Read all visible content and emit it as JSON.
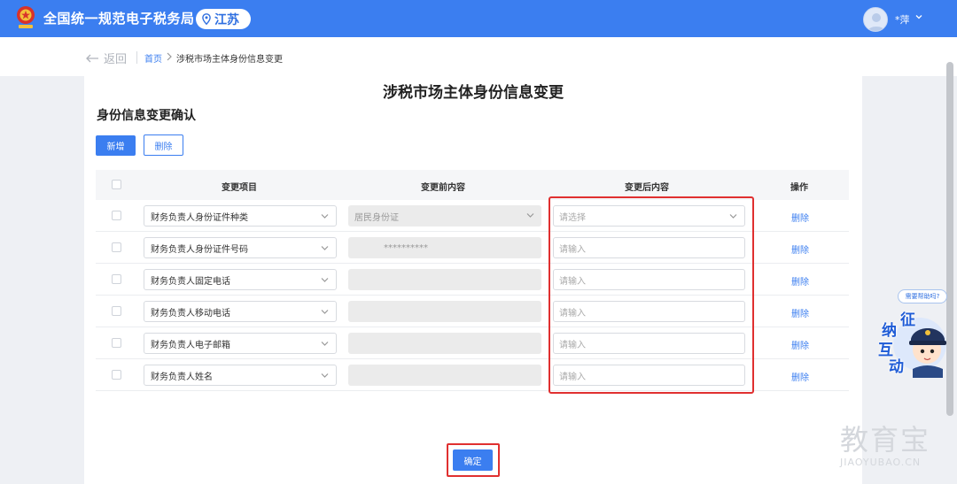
{
  "header": {
    "app_title": "全国统一规范电子税务局",
    "region": "江苏",
    "user_name": "*萍",
    "colors": {
      "brand": "#3b7ef0",
      "highlight": "#e03030"
    }
  },
  "nav": {
    "back_label": "返回",
    "breadcrumb_home": "首页",
    "breadcrumb_current": "涉税市场主体身份信息变更"
  },
  "page": {
    "title": "涉税市场主体身份信息变更",
    "section_title": "身份信息变更确认",
    "add_label": "新增",
    "delete_label": "删除",
    "confirm_label": "确定"
  },
  "table": {
    "columns": {
      "item": "变更项目",
      "before": "变更前内容",
      "after": "变更后内容",
      "action": "操作"
    },
    "rows": [
      {
        "item": "财务负责人身份证件种类",
        "before": "居民身份证",
        "after_placeholder": "请选择",
        "action": "删除"
      },
      {
        "item": "财务负责人身份证件号码",
        "before": "**********",
        "after_placeholder": "请输入",
        "action": "删除"
      },
      {
        "item": "财务负责人固定电话",
        "before": "",
        "after_placeholder": "请输入",
        "action": "删除"
      },
      {
        "item": "财务负责人移动电话",
        "before": "",
        "after_placeholder": "请输入",
        "action": "删除"
      },
      {
        "item": "财务负责人电子邮箱",
        "before": "",
        "after_placeholder": "请输入",
        "action": "删除"
      },
      {
        "item": "财务负责人姓名",
        "before": "",
        "after_placeholder": "请输入",
        "action": "删除"
      }
    ]
  },
  "assistant": {
    "bubble_text": "需要帮助吗?",
    "chars": [
      "征",
      "纳",
      "互",
      "动"
    ]
  },
  "watermark": {
    "main": "教育宝",
    "sub": "JIAOYUBAO.CN"
  }
}
